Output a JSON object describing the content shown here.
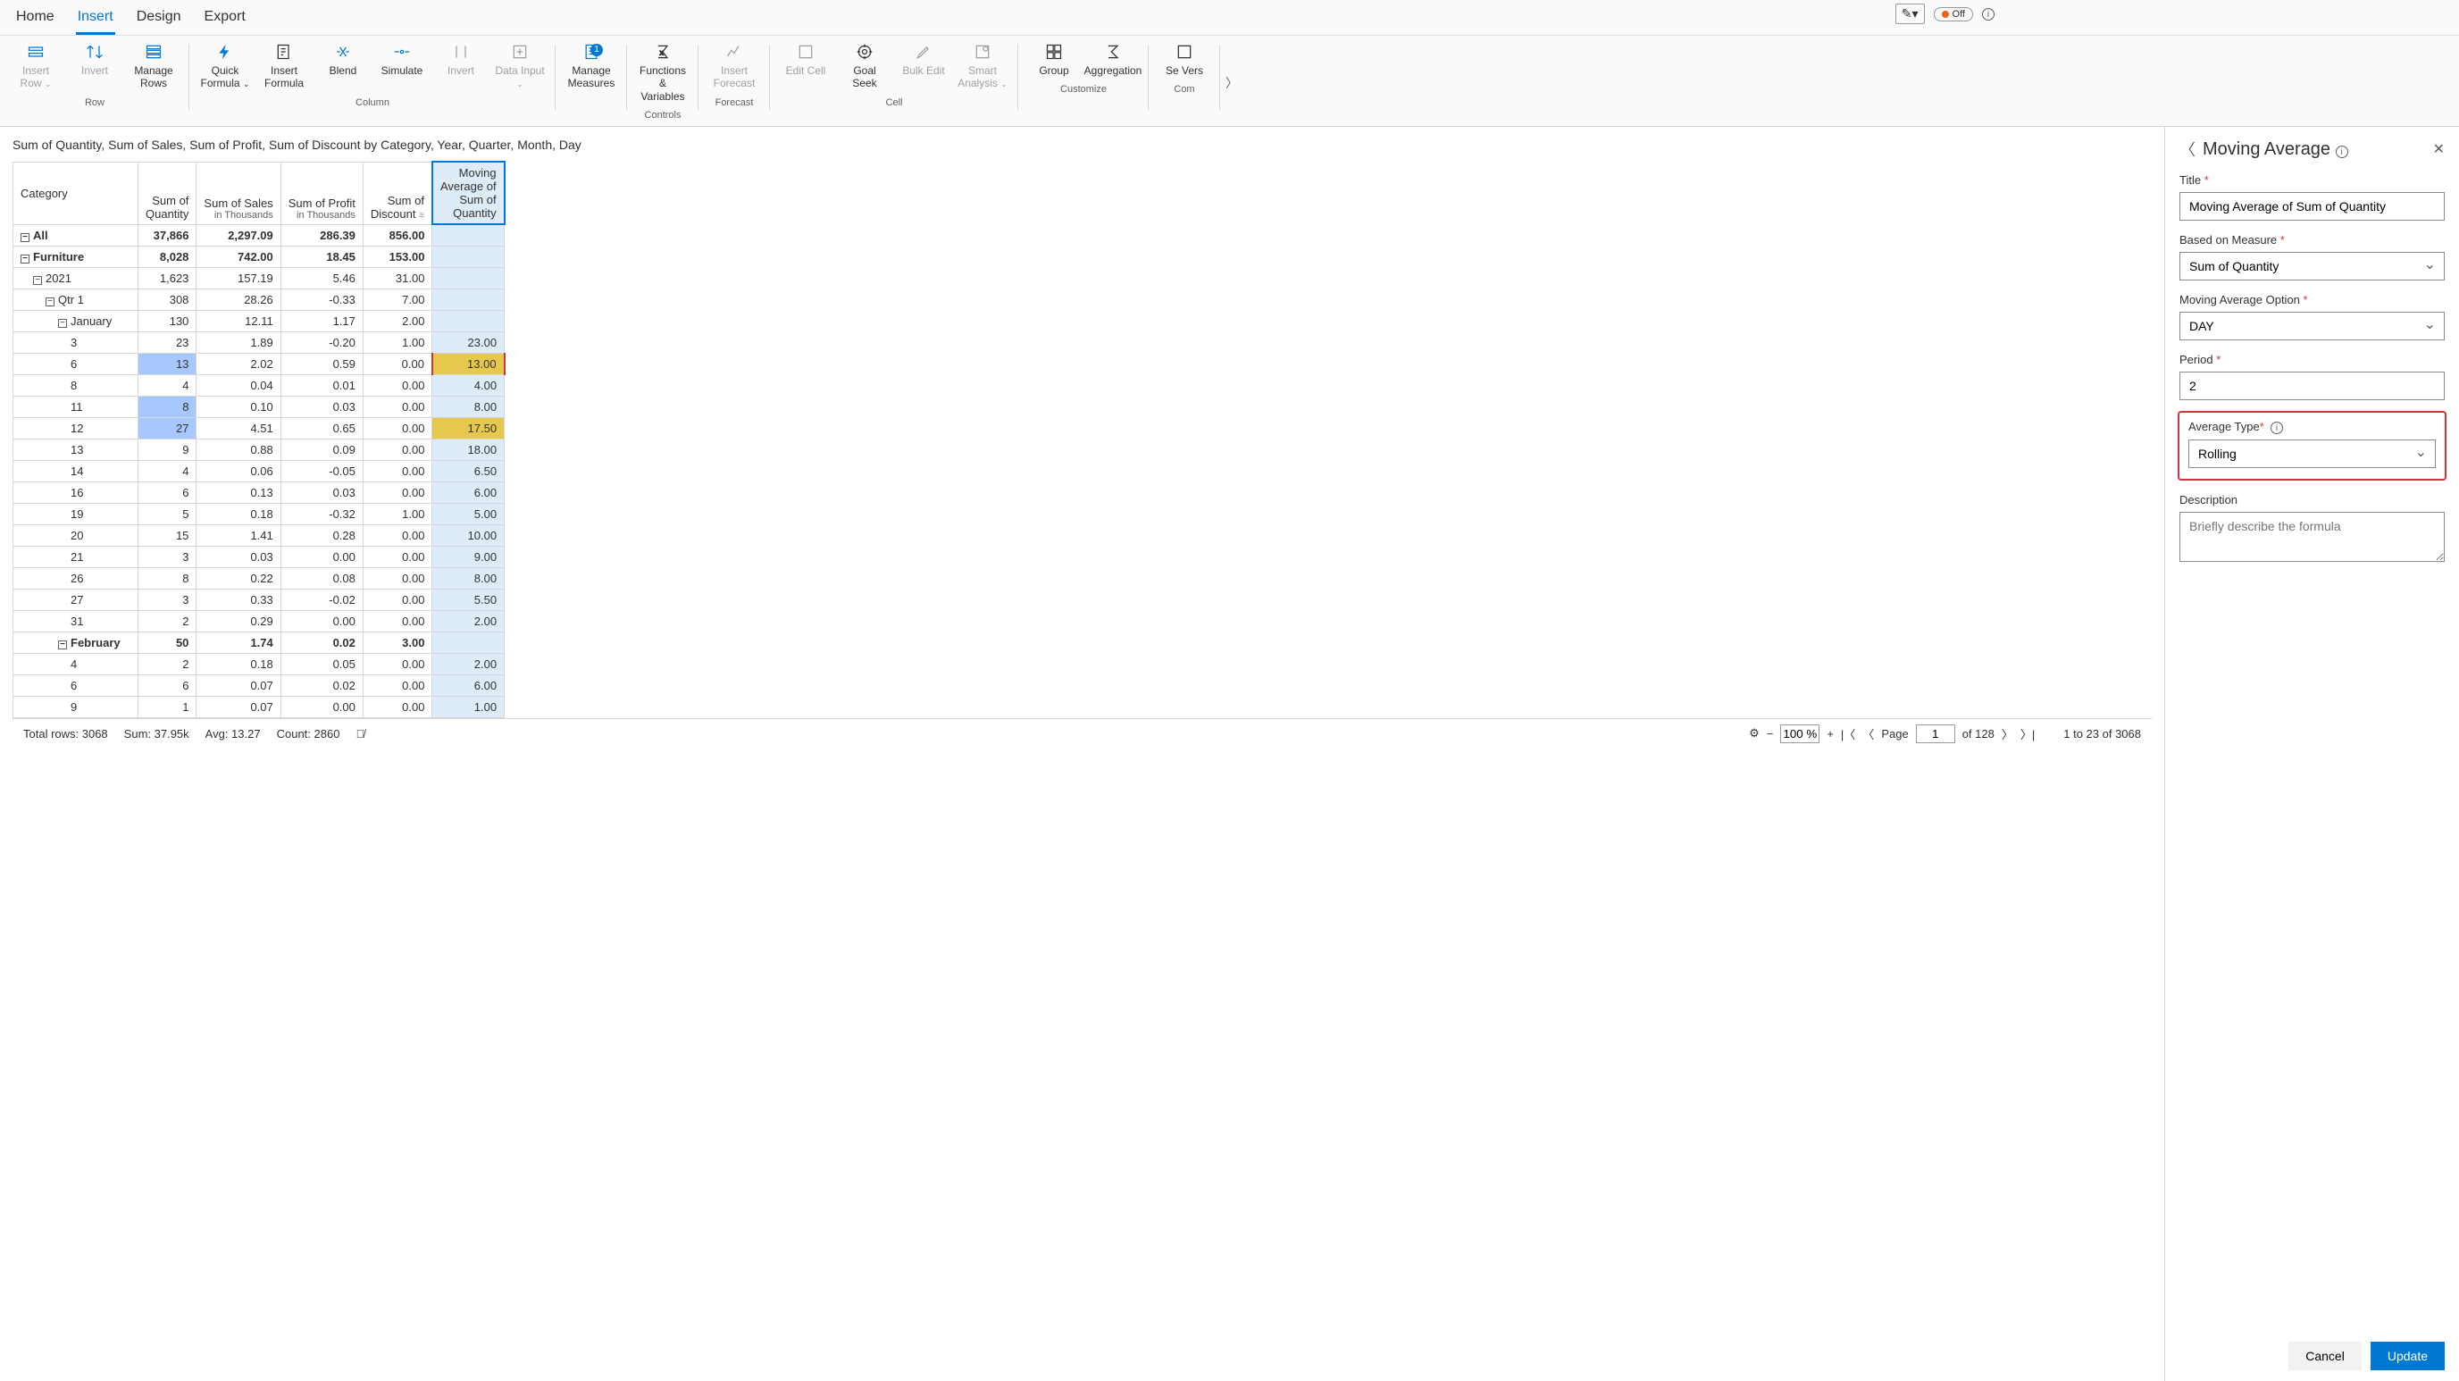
{
  "tabs": [
    "Home",
    "Insert",
    "Design",
    "Export"
  ],
  "active_tab": "Insert",
  "top_tools": {
    "toggle": "Off"
  },
  "ribbon": {
    "groups": [
      {
        "label": "Row",
        "items": [
          {
            "name": "insert-row",
            "label": "Insert Row",
            "chev": true,
            "disabled": true
          },
          {
            "name": "invert",
            "label": "Invert",
            "disabled": true
          },
          {
            "name": "manage-rows",
            "label": "Manage Rows"
          }
        ]
      },
      {
        "label": "Column",
        "items": [
          {
            "name": "quick-formula",
            "label": "Quick Formula",
            "chev": true
          },
          {
            "name": "insert-formula",
            "label": "Insert Formula"
          },
          {
            "name": "blend",
            "label": "Blend"
          },
          {
            "name": "simulate",
            "label": "Simulate"
          },
          {
            "name": "invert-col",
            "label": "Invert",
            "disabled": true
          },
          {
            "name": "data-input",
            "label": "Data Input",
            "chev": true,
            "disabled": true
          }
        ]
      },
      {
        "label": "",
        "items": [
          {
            "name": "manage-measures",
            "label": "Manage Measures",
            "badge": "1"
          }
        ]
      },
      {
        "label": "Controls",
        "items": [
          {
            "name": "functions-variables",
            "label": "Functions & Variables"
          }
        ]
      },
      {
        "label": "Forecast",
        "items": [
          {
            "name": "insert-forecast",
            "label": "Insert Forecast",
            "disabled": true
          }
        ]
      },
      {
        "label": "Cell",
        "items": [
          {
            "name": "edit-cell",
            "label": "Edit Cell",
            "disabled": true
          },
          {
            "name": "goal-seek",
            "label": "Goal Seek"
          },
          {
            "name": "bulk-edit",
            "label": "Bulk Edit",
            "disabled": true
          },
          {
            "name": "smart-analysis",
            "label": "Smart Analysis",
            "chev": true,
            "disabled": true
          }
        ]
      },
      {
        "label": "Customize",
        "items": [
          {
            "name": "group",
            "label": "Group"
          },
          {
            "name": "aggregation",
            "label": "Aggregation"
          }
        ]
      },
      {
        "label": "Com",
        "items": [
          {
            "name": "set-version",
            "label": "Se Vers"
          }
        ]
      }
    ]
  },
  "description": "Sum of Quantity, Sum of Sales, Sum of Profit, Sum of Discount by Category, Year, Quarter, Month, Day",
  "columns": [
    {
      "label": "Category"
    },
    {
      "label": "Sum of Quantity"
    },
    {
      "label": "Sum of Sales",
      "sub": "in Thousands"
    },
    {
      "label": "Sum of Profit",
      "sub": "in Thousands"
    },
    {
      "label": "Sum of Discount"
    },
    {
      "label": "Moving Average of Sum of Quantity"
    }
  ],
  "rows": [
    {
      "lvl": 0,
      "tog": "⊟",
      "label": "All",
      "b": 1,
      "c": [
        "37,866",
        "2,297.09",
        "286.39",
        "856.00",
        ""
      ]
    },
    {
      "lvl": 0,
      "tog": "⊟",
      "label": "Furniture",
      "b": 1,
      "c": [
        "8,028",
        "742.00",
        "18.45",
        "153.00",
        ""
      ]
    },
    {
      "lvl": 1,
      "tog": "⊟",
      "label": "2021",
      "c": [
        "1,623",
        "157.19",
        "5.46",
        "31.00",
        ""
      ]
    },
    {
      "lvl": 2,
      "tog": "⊟",
      "label": "Qtr 1",
      "c": [
        "308",
        "28.26",
        "-0.33",
        "7.00",
        ""
      ]
    },
    {
      "lvl": 3,
      "tog": "⊟",
      "label": "January",
      "c": [
        "130",
        "12.11",
        "1.17",
        "2.00",
        ""
      ]
    },
    {
      "lvl": 4,
      "label": "3",
      "c": [
        "23",
        "1.89",
        "-0.20",
        "1.00",
        "23.00"
      ]
    },
    {
      "lvl": 4,
      "label": "6",
      "c": [
        "13",
        "2.02",
        "0.59",
        "0.00",
        "13.00"
      ],
      "hlq": 1,
      "hlm": 1,
      "selrow": 1
    },
    {
      "lvl": 4,
      "label": "8",
      "c": [
        "4",
        "0.04",
        "0.01",
        "0.00",
        "4.00"
      ]
    },
    {
      "lvl": 4,
      "label": "11",
      "c": [
        "8",
        "0.10",
        "0.03",
        "0.00",
        "8.00"
      ],
      "hlq": 1
    },
    {
      "lvl": 4,
      "label": "12",
      "c": [
        "27",
        "4.51",
        "0.65",
        "0.00",
        "17.50"
      ],
      "hlq": 1,
      "hlm": 1
    },
    {
      "lvl": 4,
      "label": "13",
      "c": [
        "9",
        "0.88",
        "0.09",
        "0.00",
        "18.00"
      ]
    },
    {
      "lvl": 4,
      "label": "14",
      "c": [
        "4",
        "0.06",
        "-0.05",
        "0.00",
        "6.50"
      ]
    },
    {
      "lvl": 4,
      "label": "16",
      "c": [
        "6",
        "0.13",
        "0.03",
        "0.00",
        "6.00"
      ]
    },
    {
      "lvl": 4,
      "label": "19",
      "c": [
        "5",
        "0.18",
        "-0.32",
        "1.00",
        "5.00"
      ]
    },
    {
      "lvl": 4,
      "label": "20",
      "c": [
        "15",
        "1.41",
        "0.28",
        "0.00",
        "10.00"
      ]
    },
    {
      "lvl": 4,
      "label": "21",
      "c": [
        "3",
        "0.03",
        "0.00",
        "0.00",
        "9.00"
      ]
    },
    {
      "lvl": 4,
      "label": "26",
      "c": [
        "8",
        "0.22",
        "0.08",
        "0.00",
        "8.00"
      ]
    },
    {
      "lvl": 4,
      "label": "27",
      "c": [
        "3",
        "0.33",
        "-0.02",
        "0.00",
        "5.50"
      ]
    },
    {
      "lvl": 4,
      "label": "31",
      "c": [
        "2",
        "0.29",
        "0.00",
        "0.00",
        "2.00"
      ]
    },
    {
      "lvl": 3,
      "tog": "⊟",
      "label": "February",
      "b": 1,
      "c": [
        "50",
        "1.74",
        "0.02",
        "3.00",
        ""
      ]
    },
    {
      "lvl": 4,
      "label": "4",
      "c": [
        "2",
        "0.18",
        "0.05",
        "0.00",
        "2.00"
      ]
    },
    {
      "lvl": 4,
      "label": "6",
      "c": [
        "6",
        "0.07",
        "0.02",
        "0.00",
        "6.00"
      ]
    },
    {
      "lvl": 4,
      "label": "9",
      "c": [
        "1",
        "0.07",
        "0.00",
        "0.00",
        "1.00"
      ]
    }
  ],
  "status": {
    "total_rows": "Total rows: 3068",
    "sum": "Sum: 37.95k",
    "avg": "Avg: 13.27",
    "count": "Count: 2860",
    "zoom": "100 %",
    "page": "1",
    "page_of": "of 128",
    "page_label": "Page",
    "range": "1 to 23 of 3068"
  },
  "panel": {
    "title": "Moving Average",
    "fields": {
      "title": {
        "label": "Title",
        "value": "Moving Average of Sum of Quantity"
      },
      "measure": {
        "label": "Based on Measure",
        "value": "Sum of Quantity"
      },
      "option": {
        "label": "Moving Average Option",
        "value": "DAY"
      },
      "period": {
        "label": "Period",
        "value": "2"
      },
      "avgtype": {
        "label": "Average Type",
        "value": "Rolling"
      },
      "desc": {
        "label": "Description",
        "placeholder": "Briefly describe the formula"
      }
    },
    "buttons": {
      "cancel": "Cancel",
      "update": "Update"
    }
  }
}
